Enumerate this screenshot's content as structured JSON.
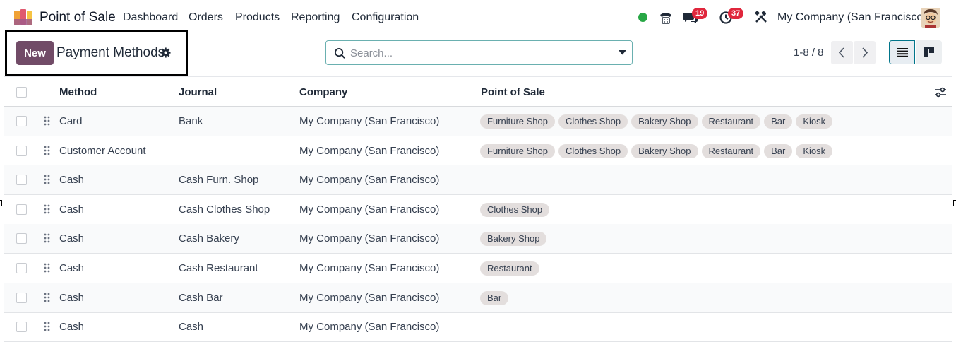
{
  "navbar": {
    "app_name": "Point of Sale",
    "menu": [
      "Dashboard",
      "Orders",
      "Products",
      "Reporting",
      "Configuration"
    ],
    "messages_count": "19",
    "activities_count": "37",
    "company": "My Company (San Francisco)"
  },
  "control_panel": {
    "new_label": "New",
    "title": "Payment Methods",
    "search_placeholder": "Search...",
    "pager": "1-8 / 8"
  },
  "table": {
    "columns": [
      "Method",
      "Journal",
      "Company",
      "Point of Sale"
    ],
    "rows": [
      {
        "method": "Card",
        "journal": "Bank",
        "company": "My Company (San Francisco)",
        "pos": [
          "Furniture Shop",
          "Clothes Shop",
          "Bakery Shop",
          "Restaurant",
          "Bar",
          "Kiosk"
        ]
      },
      {
        "method": "Customer Account",
        "journal": "",
        "company": "My Company (San Francisco)",
        "pos": [
          "Furniture Shop",
          "Clothes Shop",
          "Bakery Shop",
          "Restaurant",
          "Bar",
          "Kiosk"
        ]
      },
      {
        "method": "Cash",
        "journal": "Cash Furn. Shop",
        "company": "My Company (San Francisco)",
        "pos": []
      },
      {
        "method": "Cash",
        "journal": "Cash Clothes Shop",
        "company": "My Company (San Francisco)",
        "pos": [
          "Clothes Shop"
        ]
      },
      {
        "method": "Cash",
        "journal": "Cash Bakery",
        "company": "My Company (San Francisco)",
        "pos": [
          "Bakery Shop"
        ]
      },
      {
        "method": "Cash",
        "journal": "Cash Restaurant",
        "company": "My Company (San Francisco)",
        "pos": [
          "Restaurant"
        ]
      },
      {
        "method": "Cash",
        "journal": "Cash Bar",
        "company": "My Company (San Francisco)",
        "pos": [
          "Bar"
        ]
      },
      {
        "method": "Cash",
        "journal": "Cash",
        "company": "My Company (San Francisco)",
        "pos": []
      }
    ]
  },
  "icons": {
    "logo": "pos-logo-icon",
    "status": "online-status-icon",
    "phone": "phone-icon",
    "messages": "chat-icon",
    "activities": "clock-icon",
    "debug": "tools-icon",
    "settings": "gear-icon",
    "search": "search-icon",
    "search_toggle": "caret-down-icon",
    "prev": "chevron-left-icon",
    "next": "chevron-right-icon",
    "list_view": "list-view-icon",
    "kanban_view": "kanban-view-icon",
    "optional_columns": "sliders-icon",
    "row_handle": "drag-handle-icon"
  },
  "colors": {
    "primary": "#714b67",
    "badge": "#e0263c",
    "online": "#28a745",
    "tag_bg": "#e3dedd"
  }
}
